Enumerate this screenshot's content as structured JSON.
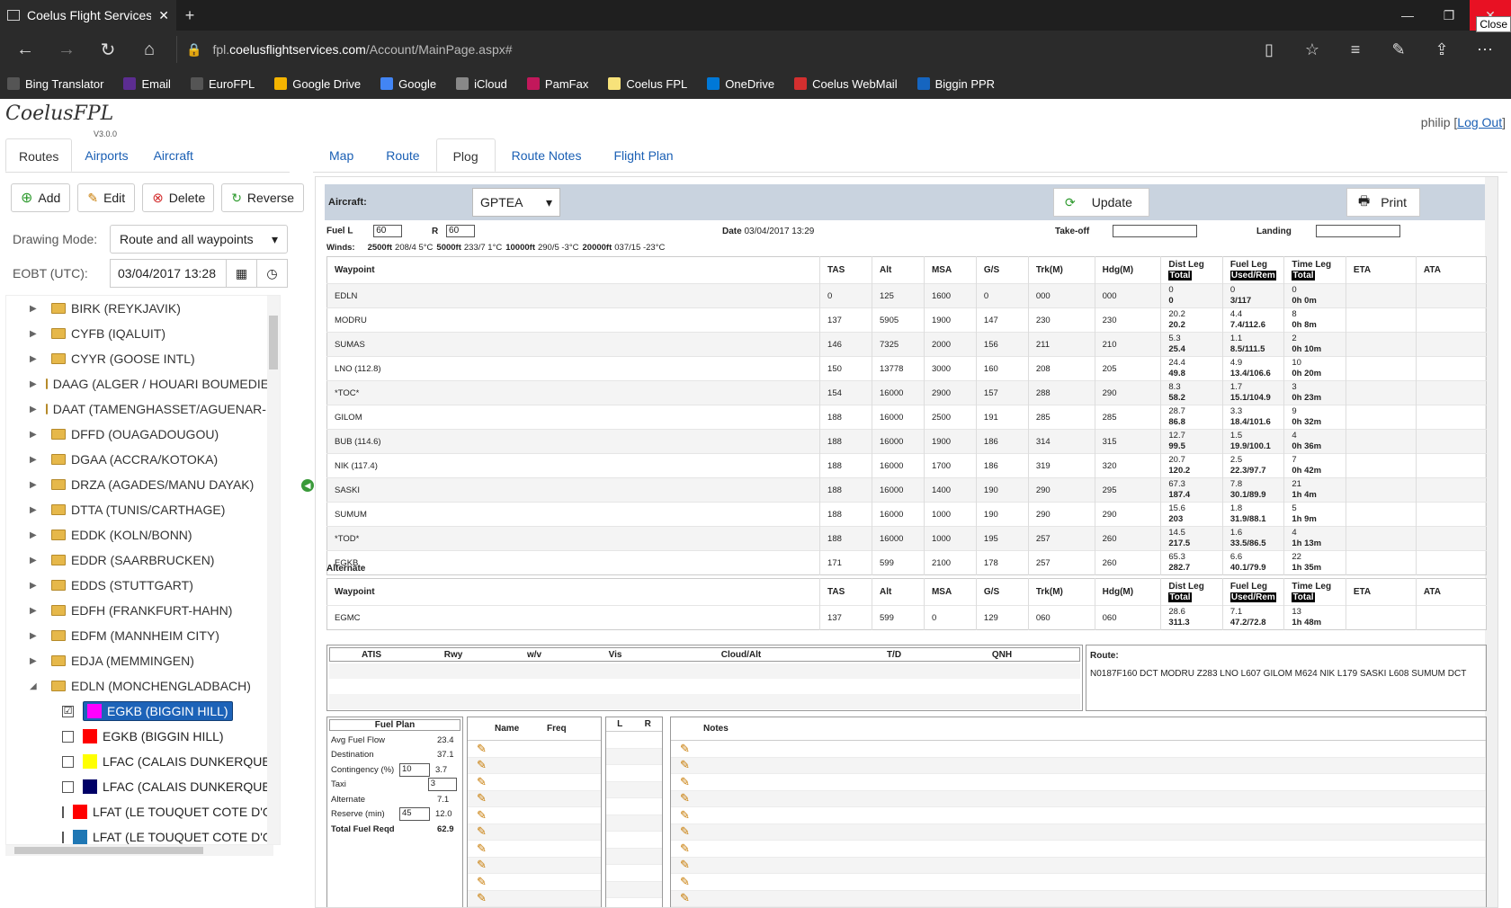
{
  "browser": {
    "tab_title": "Coelus Flight Services Fl",
    "url_prefix": "fpl.",
    "url_domain": "coelusflightservices.com",
    "url_path": "/Account/MainPage.aspx#",
    "close_tooltip": "Close",
    "favorites": [
      {
        "label": "Bing Translator",
        "color": "#555"
      },
      {
        "label": "Email",
        "color": "#5c2d91"
      },
      {
        "label": "EuroFPL",
        "color": "#555"
      },
      {
        "label": "Google Drive",
        "color": "#f4b400"
      },
      {
        "label": "Google",
        "color": "#4285f4"
      },
      {
        "label": "iCloud",
        "color": "#888"
      },
      {
        "label": "PamFax",
        "color": "#c2185b"
      },
      {
        "label": "Coelus FPL",
        "color": "#f7e27a"
      },
      {
        "label": "OneDrive",
        "color": "#0078d7"
      },
      {
        "label": "Coelus WebMail",
        "color": "#d32f2f"
      },
      {
        "label": "Biggin PPR",
        "color": "#1565c0"
      }
    ]
  },
  "app": {
    "logo": "CoelusFPL",
    "version": "V3.0.0",
    "user": "philip",
    "logout_prefix": "[",
    "logout": "Log Out",
    "logout_suffix": "]"
  },
  "left": {
    "tabs": [
      "Routes",
      "Airports",
      "Aircraft"
    ],
    "buttons": {
      "add": "Add",
      "edit": "Edit",
      "delete": "Delete",
      "reverse": "Reverse"
    },
    "drawing_mode_label": "Drawing Mode:",
    "drawing_mode_value": "Route and all waypoints",
    "eobt_label": "EOBT (UTC):",
    "eobt_value": "03/04/2017 13:28",
    "folders": [
      "BIRK (REYKJAVIK)",
      "CYFB (IQALUIT)",
      "CYYR (GOOSE INTL)",
      "DAAG (ALGER / HOUARI BOUMEDIENE)",
      "DAAT (TAMENGHASSET/AGUENAR-HADJ",
      "DFFD (OUAGADOUGOU)",
      "DGAA (ACCRA/KOTOKA)",
      "DRZA (AGADES/MANU DAYAK)",
      "DTTA (TUNIS/CARTHAGE)",
      "EDDK (KOLN/BONN)",
      "EDDR (SAARBRUCKEN)",
      "EDDS (STUTTGART)",
      "EDFH (FRANKFURT-HAHN)",
      "EDFM (MANNHEIM CITY)",
      "EDJA (MEMMINGEN)",
      "EDLN (MONCHENGLADBACH)"
    ],
    "children": [
      {
        "label": "EGKB (BIGGIN HILL)",
        "color": "#ff00ff",
        "checked": "☑"
      },
      {
        "label": "EGKB (BIGGIN HILL)",
        "color": "#ff0000",
        "checked": ""
      },
      {
        "label": "LFAC (CALAIS DUNKERQUE)",
        "color": "#ffff00",
        "checked": ""
      },
      {
        "label": "LFAC (CALAIS DUNKERQUE)",
        "color": "#000066",
        "checked": ""
      },
      {
        "label": "LFAT (LE TOUQUET COTE D'OPAL",
        "color": "#ff0000",
        "checked": ""
      },
      {
        "label": "LFAT (LE TOUQUET COTE D'OPAL",
        "color": "#1f77b4",
        "checked": ""
      }
    ]
  },
  "main": {
    "tabs": [
      "Map",
      "Route",
      "Plog",
      "Route Notes",
      "Flight Plan"
    ],
    "aircraft_label": "Aircraft:",
    "aircraft": "GPTEA",
    "update": "Update",
    "print": "Print",
    "fuel_l_label": "Fuel L",
    "fuel_l": "60",
    "fuel_r_label": "R",
    "fuel_r": "60",
    "date_label": "Date",
    "date": "03/04/2017 13:29",
    "takeoff_label": "Take-off",
    "landing_label": "Landing",
    "winds_label": "Winds:",
    "winds": [
      {
        "alt": "2500ft",
        "val": "208/4 5°C"
      },
      {
        "alt": "5000ft",
        "val": "233/7 1°C"
      },
      {
        "alt": "10000ft",
        "val": "290/5 -3°C"
      },
      {
        "alt": "20000ft",
        "val": "037/15 -23°C"
      }
    ],
    "plog_headers": [
      "Waypoint",
      "TAS",
      "Alt",
      "MSA",
      "G/S",
      "Trk(M)",
      "Hdg(M)",
      "Dist Leg",
      "Total",
      "Fuel Leg",
      "Used/Rem",
      "Time Leg",
      "Total",
      "ETA",
      "ATA"
    ],
    "plog_rows": [
      [
        "EDLN",
        "0",
        "125",
        "1600",
        "0",
        "000",
        "000",
        "0",
        "0",
        "0",
        "3/117",
        "0",
        "0h 0m"
      ],
      [
        "MODRU",
        "137",
        "5905",
        "1900",
        "147",
        "230",
        "230",
        "20.2",
        "20.2",
        "4.4",
        "7.4/112.6",
        "8",
        "0h 8m"
      ],
      [
        "SUMAS",
        "146",
        "7325",
        "2000",
        "156",
        "211",
        "210",
        "5.3",
        "25.4",
        "1.1",
        "8.5/111.5",
        "2",
        "0h 10m"
      ],
      [
        "LNO (112.8)",
        "150",
        "13778",
        "3000",
        "160",
        "208",
        "205",
        "24.4",
        "49.8",
        "4.9",
        "13.4/106.6",
        "10",
        "0h 20m"
      ],
      [
        "*TOC*",
        "154",
        "16000",
        "2900",
        "157",
        "288",
        "290",
        "8.3",
        "58.2",
        "1.7",
        "15.1/104.9",
        "3",
        "0h 23m"
      ],
      [
        "GILOM",
        "188",
        "16000",
        "2500",
        "191",
        "285",
        "285",
        "28.7",
        "86.8",
        "3.3",
        "18.4/101.6",
        "9",
        "0h 32m"
      ],
      [
        "BUB (114.6)",
        "188",
        "16000",
        "1900",
        "186",
        "314",
        "315",
        "12.7",
        "99.5",
        "1.5",
        "19.9/100.1",
        "4",
        "0h 36m"
      ],
      [
        "NIK (117.4)",
        "188",
        "16000",
        "1700",
        "186",
        "319",
        "320",
        "20.7",
        "120.2",
        "2.5",
        "22.3/97.7",
        "7",
        "0h 42m"
      ],
      [
        "SASKI",
        "188",
        "16000",
        "1400",
        "190",
        "290",
        "295",
        "67.3",
        "187.4",
        "7.8",
        "30.1/89.9",
        "21",
        "1h 4m"
      ],
      [
        "SUMUM",
        "188",
        "16000",
        "1000",
        "190",
        "290",
        "290",
        "15.6",
        "203",
        "1.8",
        "31.9/88.1",
        "5",
        "1h 9m"
      ],
      [
        "*TOD*",
        "188",
        "16000",
        "1000",
        "195",
        "257",
        "260",
        "14.5",
        "217.5",
        "1.6",
        "33.5/86.5",
        "4",
        "1h 13m"
      ],
      [
        "EGKB",
        "171",
        "599",
        "2100",
        "178",
        "257",
        "260",
        "65.3",
        "282.7",
        "6.6",
        "40.1/79.9",
        "22",
        "1h 35m"
      ]
    ],
    "alternate_label": "Alternate",
    "alt_row": [
      "EGMC",
      "137",
      "599",
      "0",
      "129",
      "060",
      "060",
      "28.6",
      "311.3",
      "7.1",
      "47.2/72.8",
      "13",
      "1h 48m"
    ],
    "wx_headers": [
      "ATIS",
      "Rwy",
      "w/v",
      "Vis",
      "Cloud/Alt",
      "T/D",
      "QNH"
    ],
    "route_label": "Route:",
    "route_text": "N0187F160 DCT MODRU Z283 LNO L607 GILOM M624 NIK L179 SASKI L608 SUMUM DCT",
    "fuel_plan": {
      "title": "Fuel Plan",
      "rows": [
        {
          "k": "Avg Fuel Flow",
          "v": "23.4"
        },
        {
          "k": "Destination",
          "v": "37.1"
        },
        {
          "k": "Contingency (%)",
          "in": "10",
          "v": "3.7"
        },
        {
          "k": "Taxi",
          "in": "3",
          "v": ""
        },
        {
          "k": "Alternate",
          "v": "7.1"
        },
        {
          "k": "Reserve (min)",
          "in": "45",
          "v": "12.0"
        },
        {
          "k": "Total Fuel Reqd",
          "v": "62.9"
        }
      ]
    },
    "freq_headers": [
      "Name",
      "Freq"
    ],
    "lr_headers": [
      "L",
      "R"
    ],
    "notes_header": "Notes"
  }
}
